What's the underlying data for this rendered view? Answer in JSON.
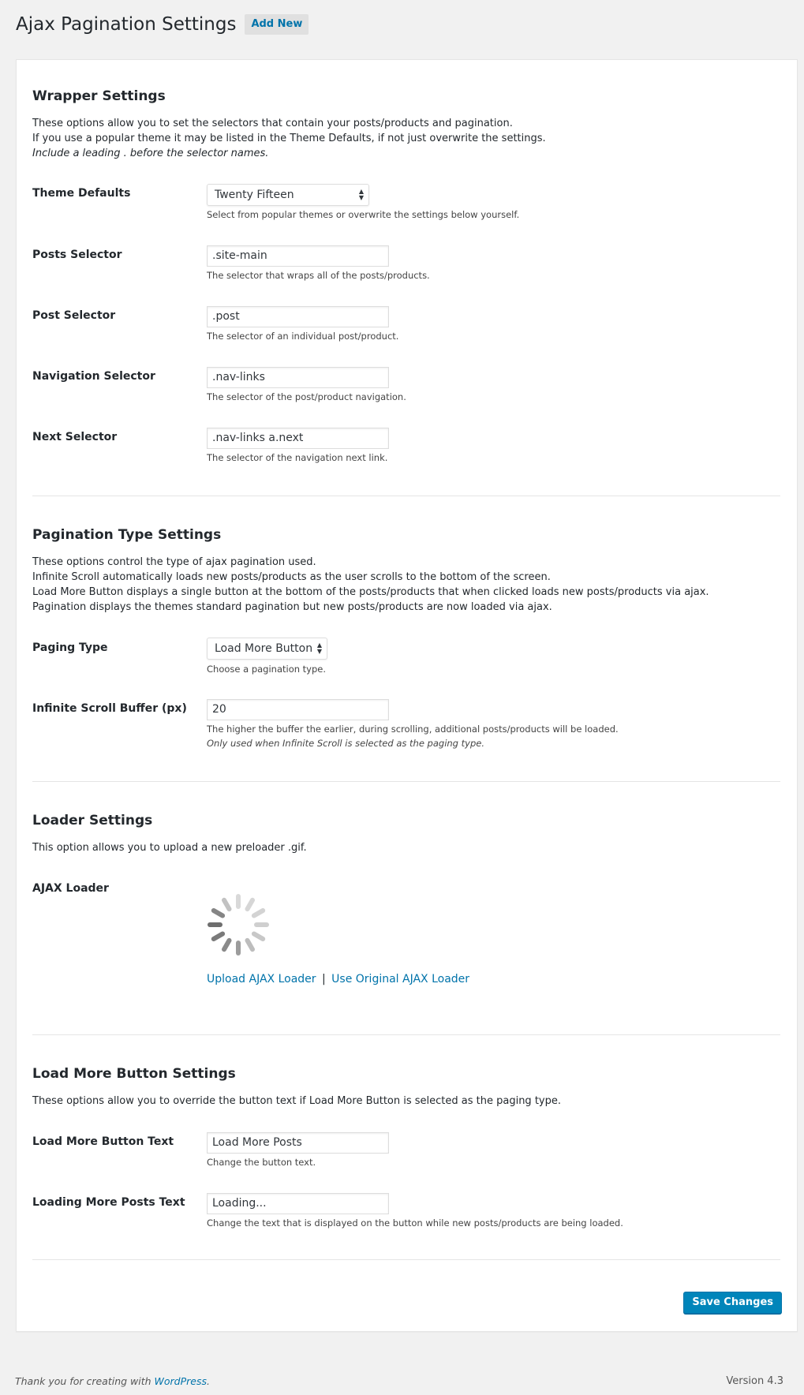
{
  "header": {
    "title": "Ajax Pagination Settings",
    "add_new_label": "Add New"
  },
  "wrapper": {
    "title": "Wrapper Settings",
    "desc_line1": "These options allow you to set the selectors that contain your posts/products and pagination.",
    "desc_line2": "If you use a popular theme it may be listed in the Theme Defaults, if not just overwrite the settings.",
    "desc_line3": "Include a leading . before the selector names.",
    "theme_defaults": {
      "label": "Theme Defaults",
      "value": "Twenty Fifteen",
      "help": "Select from popular themes or overwrite the settings below yourself."
    },
    "posts_selector": {
      "label": "Posts Selector",
      "value": ".site-main",
      "help": "The selector that wraps all of the posts/products."
    },
    "post_selector": {
      "label": "Post Selector",
      "value": ".post",
      "help": "The selector of an individual post/product."
    },
    "navigation_selector": {
      "label": "Navigation Selector",
      "value": ".nav-links",
      "help": "The selector of the post/product navigation."
    },
    "next_selector": {
      "label": "Next Selector",
      "value": ".nav-links a.next",
      "help": "The selector of the navigation next link."
    }
  },
  "pagination": {
    "title": "Pagination Type Settings",
    "desc_line1": "These options control the type of ajax pagination used.",
    "desc_line2": "Infinite Scroll automatically loads new posts/products as the user scrolls to the bottom of the screen.",
    "desc_line3": "Load More Button displays a single button at the bottom of the posts/products that when clicked loads new posts/products via ajax.",
    "desc_line4": "Pagination displays the themes standard pagination but new posts/products are now loaded via ajax.",
    "paging_type": {
      "label": "Paging Type",
      "value": "Load More Button",
      "help": "Choose a pagination type."
    },
    "buffer": {
      "label": "Infinite Scroll Buffer (px)",
      "value": "20",
      "help1": "The higher the buffer the earlier, during scrolling, additional posts/products will be loaded.",
      "help2": "Only used when Infinite Scroll is selected as the paging type."
    }
  },
  "loader": {
    "title": "Loader Settings",
    "desc": "This option allows you to upload a new preloader .gif.",
    "label": "AJAX Loader",
    "upload_link": "Upload AJAX Loader",
    "separator": "|",
    "original_link": "Use Original AJAX Loader",
    "spinner_icon": "spinner-icon"
  },
  "load_more": {
    "title": "Load More Button Settings",
    "desc": "These options allow you to override the button text if Load More Button is selected as the paging type.",
    "button_text": {
      "label": "Load More Button Text",
      "value": "Load More Posts",
      "help": "Change the button text."
    },
    "loading_text": {
      "label": "Loading More Posts Text",
      "value": "Loading...",
      "help": "Change the text that is displayed on the button while new posts/products are being loaded."
    }
  },
  "actions": {
    "save_label": "Save Changes"
  },
  "footer": {
    "thanks_prefix": "Thank you for creating with ",
    "wordpress_link": "WordPress",
    "thanks_suffix": ".",
    "version": "Version 4.3"
  },
  "colors": {
    "accent": "#0073aa",
    "primary_button": "#0085ba",
    "background": "#f1f1f1"
  }
}
